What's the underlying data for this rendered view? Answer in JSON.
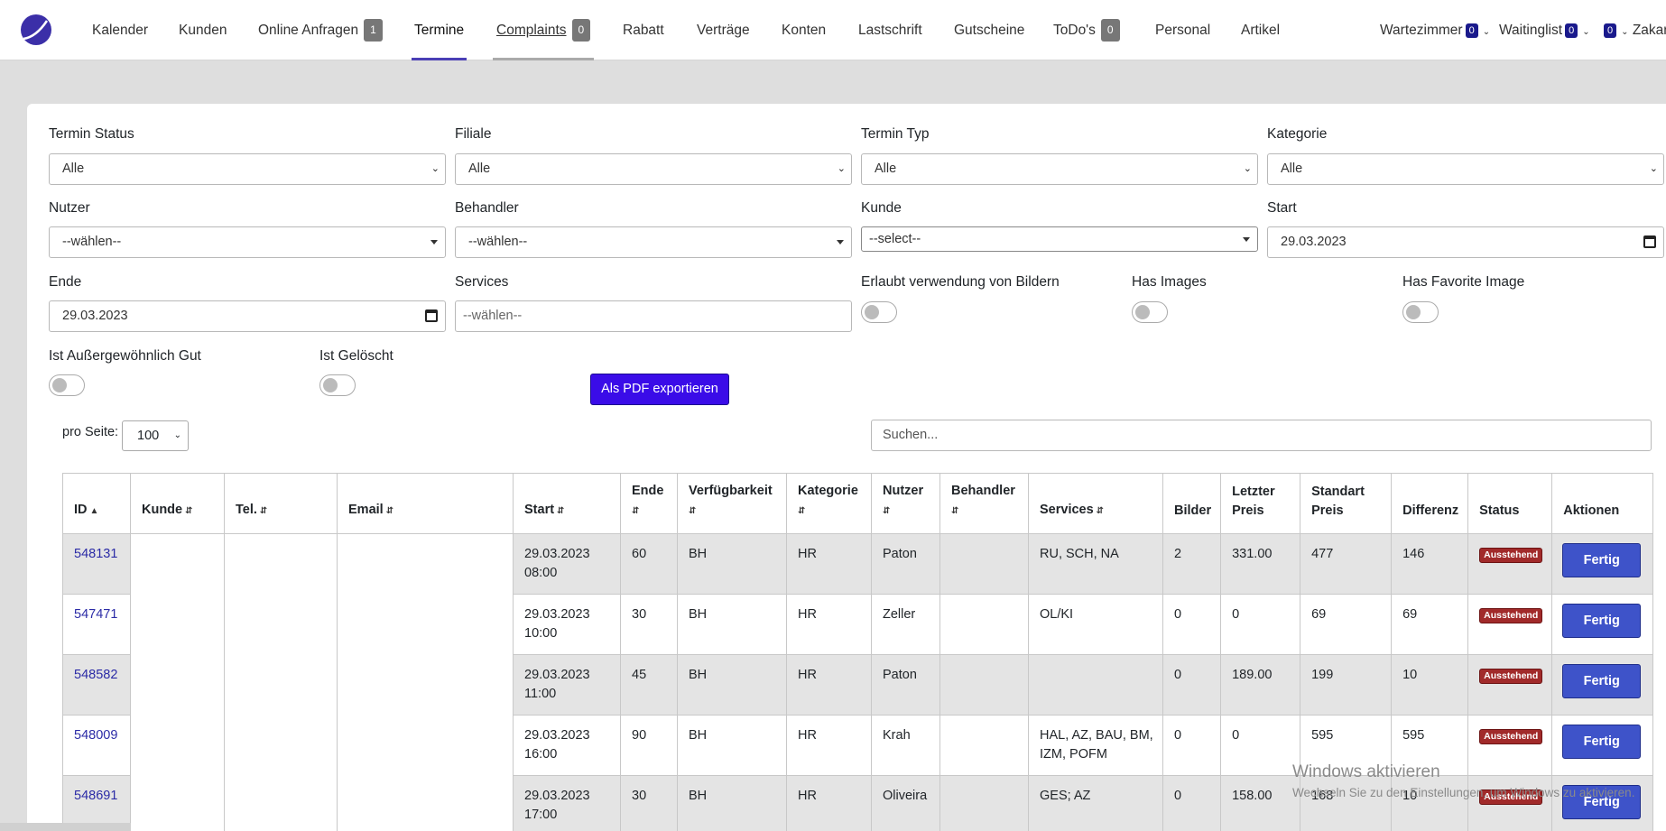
{
  "nav": {
    "items": [
      {
        "label": "Kalender"
      },
      {
        "label": "Kunden"
      },
      {
        "label": "Online Anfragen",
        "badge": "1"
      },
      {
        "label": "Termine"
      },
      {
        "label": "Complaints",
        "badge": "0"
      },
      {
        "label": "Rabatt"
      },
      {
        "label": "Verträge"
      },
      {
        "label": "Konten"
      },
      {
        "label": "Lastschrift"
      },
      {
        "label": "Gutscheine"
      },
      {
        "label": "ToDo's",
        "badge": "0"
      },
      {
        "label": "Personal"
      },
      {
        "label": "Artikel"
      }
    ],
    "right": {
      "wartezimmer": {
        "label": "Wartezimmer",
        "badge": "0"
      },
      "waitinglist": {
        "label": "Waitinglist",
        "badge": "0"
      },
      "user": {
        "badge": "0",
        "name": "Zakar"
      }
    }
  },
  "filters": {
    "termin_status": {
      "label": "Termin Status",
      "value": "Alle"
    },
    "filiale": {
      "label": "Filiale",
      "value": "Alle"
    },
    "termin_typ": {
      "label": "Termin Typ",
      "value": "Alle"
    },
    "kategorie": {
      "label": "Kategorie",
      "value": "Alle"
    },
    "nutzer": {
      "label": "Nutzer",
      "value": "--wählen--"
    },
    "behandler": {
      "label": "Behandler",
      "value": "--wählen--"
    },
    "kunde": {
      "label": "Kunde",
      "value": "--select--"
    },
    "start": {
      "label": "Start",
      "value": "29.03.2023"
    },
    "ende": {
      "label": "Ende",
      "value": "29.03.2023"
    },
    "services": {
      "label": "Services",
      "placeholder": "--wählen--"
    },
    "erlaubt_bilder": {
      "label": "Erlaubt verwendung von Bildern"
    },
    "has_images": {
      "label": "Has Images"
    },
    "has_favorite_image": {
      "label": "Has Favorite Image"
    },
    "aussergewoehnlich": {
      "label": "Ist Außergewöhnlich Gut"
    },
    "geloescht": {
      "label": "Ist Gelöscht"
    }
  },
  "export_button": "Als PDF exportieren",
  "per_page": {
    "label": "pro Seite:",
    "value": "100"
  },
  "search": {
    "placeholder": "Suchen..."
  },
  "table": {
    "headers": {
      "id": "ID",
      "kunde": "Kunde",
      "tel": "Tel.",
      "email": "Email",
      "start": "Start",
      "ende": "Ende",
      "verfuegbarkeit": "Verfügbarkeit",
      "kategorie": "Kategorie",
      "nutzer": "Nutzer",
      "behandler": "Behandler",
      "services": "Services",
      "bilder": "Bilder",
      "letzter_preis": "Letzter Preis",
      "standart_preis": "Standart Preis",
      "differenz": "Differenz",
      "status": "Status",
      "aktionen": "Aktionen"
    },
    "rows": [
      {
        "id": "548131",
        "start_date": "29.03.2023",
        "start_time": "08:00",
        "ende": "60",
        "verfuegbarkeit": "BH",
        "kategorie": "HR",
        "nutzer": "Paton",
        "behandler": "",
        "services": "RU, SCH, NA",
        "bilder": "2",
        "letzter_preis": "331.00",
        "standart_preis": "477",
        "differenz": "146",
        "status": "Ausstehend",
        "action": "Fertig"
      },
      {
        "id": "547471",
        "start_date": "29.03.2023",
        "start_time": "10:00",
        "ende": "30",
        "verfuegbarkeit": "BH",
        "kategorie": "HR",
        "nutzer": "Zeller",
        "behandler": "",
        "services": "OL/KI",
        "bilder": "0",
        "letzter_preis": "0",
        "standart_preis": "69",
        "differenz": "69",
        "status": "Ausstehend",
        "action": "Fertig"
      },
      {
        "id": "548582",
        "start_date": "29.03.2023",
        "start_time": "11:00",
        "ende": "45",
        "verfuegbarkeit": "BH",
        "kategorie": "HR",
        "nutzer": "Paton",
        "behandler": "",
        "services": "",
        "bilder": "0",
        "letzter_preis": "189.00",
        "standart_preis": "199",
        "differenz": "10",
        "status": "Ausstehend",
        "action": "Fertig"
      },
      {
        "id": "548009",
        "start_date": "29.03.2023",
        "start_time": "16:00",
        "ende": "90",
        "verfuegbarkeit": "BH",
        "kategorie": "HR",
        "nutzer": "Krah",
        "behandler": "",
        "services": "HAL, AZ, BAU, BM, IZM, POFM",
        "bilder": "0",
        "letzter_preis": "0",
        "standart_preis": "595",
        "differenz": "595",
        "status": "Ausstehend",
        "action": "Fertig"
      },
      {
        "id": "548691",
        "start_date": "29.03.2023",
        "start_time": "17:00",
        "ende": "30",
        "verfuegbarkeit": "BH",
        "kategorie": "HR",
        "nutzer": "Oliveira",
        "behandler": "",
        "services": "GES; AZ",
        "bilder": "0",
        "letzter_preis": "158.00",
        "standart_preis": "168",
        "differenz": "10",
        "status": "Ausstehend",
        "action": "Fertig"
      }
    ]
  },
  "watermark": {
    "title": "Windows aktivieren",
    "subtitle": "Wechseln Sie zu den Einstellungen, um Windows zu aktivieren."
  },
  "colors": {
    "accent": "#3a0ce8",
    "action_button": "#3e53c9",
    "status_badge": "#a12a2a"
  }
}
